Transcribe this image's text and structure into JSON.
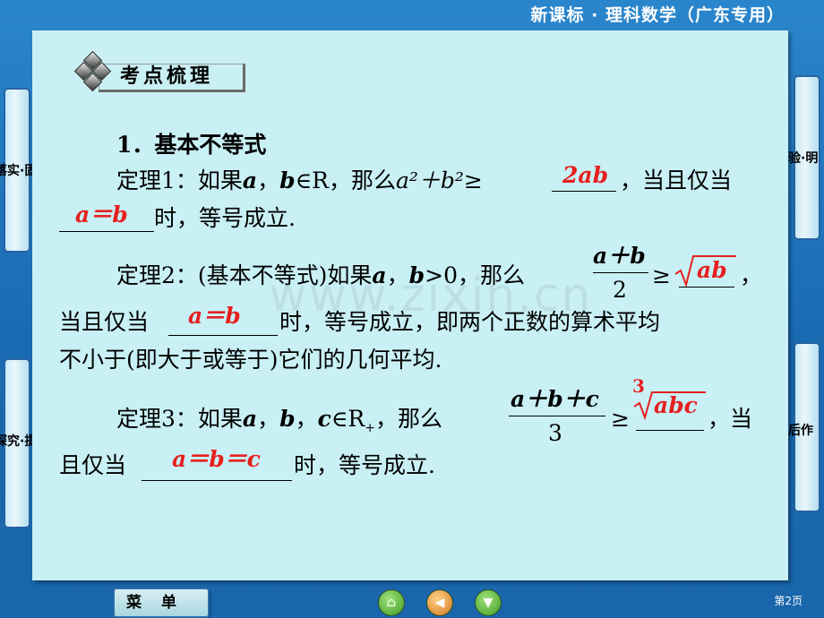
{
  "header": {
    "title": "新课标 · 理科数学（广东专用）"
  },
  "side_tabs": {
    "left_top": "落实·固基础",
    "left_bottom": "探究·提知能",
    "right_top": "高考体验·明",
    "right_bottom": "课后作"
  },
  "section": {
    "title": "考点梳理"
  },
  "content": {
    "heading": "1．基本不等式",
    "t1": {
      "prefix": "定理1：如果",
      "a": "a",
      "comma1": "，",
      "b": "b",
      "in_r": "∈R，那么",
      "expr": "a²＋b²≥",
      "answer1": "2ab",
      "mid": "，当且仅当",
      "answer2": "a＝b",
      "suffix": "时，等号成立."
    },
    "t2": {
      "prefix": "定理2：(基本不等式)如果",
      "a": "a",
      "comma": "，",
      "b": "b",
      "cond": ">0，那么",
      "frac_num": "a＋b",
      "frac_den": "2",
      "geq": "≥",
      "answer1": "ab",
      "comma_end": "，",
      "line2_prefix": "当且仅当",
      "answer2": "a＝b",
      "line2_suffix": "时，等号成立，即两个正数的算术平均",
      "line3": "不小于(即大于或等于)它们的几何平均."
    },
    "t3": {
      "prefix": "定理3：如果",
      "a": "a",
      "comma1": "，",
      "b": "b",
      "comma2": "，",
      "c": "c",
      "in_r": "∈R",
      "plus_sub": "+",
      "then": "，那么",
      "frac_num": "a＋b＋c",
      "frac_den": "3",
      "geq": "≥",
      "root_index": "3",
      "answer1": "abc",
      "comma_end": "，当",
      "line2_prefix": "且仅当",
      "answer2": "a＝b＝c",
      "line2_suffix": "时，等号成立."
    }
  },
  "watermark": "www.zixin.cn",
  "footer": {
    "menu_label": "菜单",
    "page": "第2页"
  },
  "colors": {
    "frame": "#1f74b8",
    "panel": "#c9f0f4",
    "answer": "#e62020"
  },
  "icons": [
    "home-icon",
    "back-icon",
    "forward-icon"
  ]
}
